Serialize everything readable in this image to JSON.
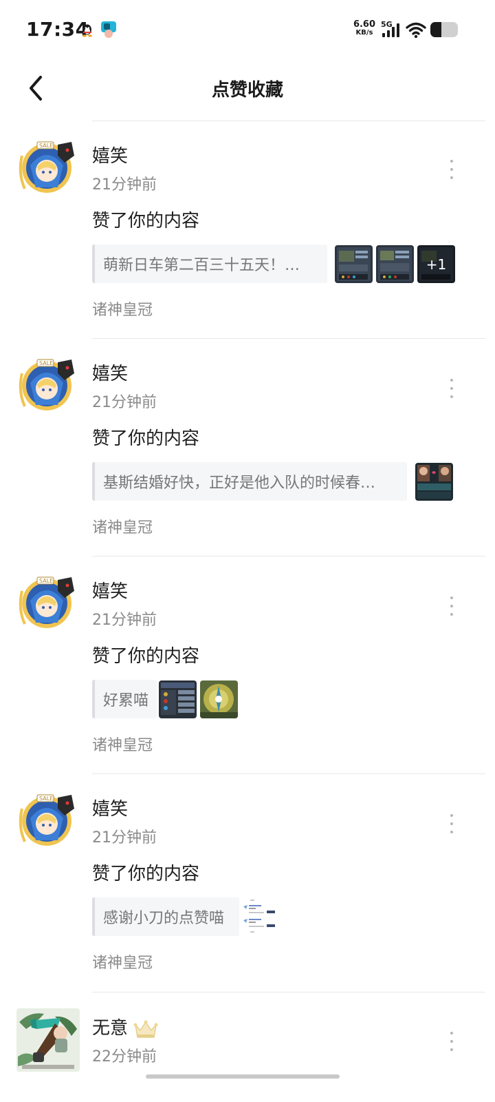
{
  "status_bar": {
    "time": "17:34",
    "net_speed_value": "6.60",
    "net_speed_unit": "KB/s",
    "network": "5G",
    "icons": [
      "qq-icon",
      "app-notification-icon",
      "signal-icon",
      "wifi-icon",
      "battery-icon"
    ]
  },
  "header": {
    "title": "点赞收藏",
    "back_icon": "back-arrow-icon"
  },
  "items": [
    {
      "user": "嬉笑",
      "time": "21分钟前",
      "action": "赞了你的内容",
      "quote": "萌新日车第二百三十五天！…",
      "thumbnails": [
        "game-screenshot",
        "game-screenshot",
        "game-screenshot"
      ],
      "more_count": "+1",
      "source": "诸神皇冠"
    },
    {
      "user": "嬉笑",
      "time": "21分钟前",
      "action": "赞了你的内容",
      "quote": "基斯结婚好快，正好是他入队的时候春…",
      "thumbnails": [
        "game-screenshot"
      ],
      "source": "诸神皇冠"
    },
    {
      "user": "嬉笑",
      "time": "21分钟前",
      "action": "赞了你的内容",
      "quote": "好累喵",
      "thumbnails": [
        "game-screenshot",
        "game-screenshot"
      ],
      "source": "诸神皇冠"
    },
    {
      "user": "嬉笑",
      "time": "21分钟前",
      "action": "赞了你的内容",
      "quote": "感谢小刀的点赞喵",
      "thumbnails": [
        "comment-screenshot"
      ],
      "source": "诸神皇冠"
    },
    {
      "user": "无意",
      "badge_icon": "crown-icon",
      "time": "22分钟前"
    }
  ],
  "colors": {
    "text_primary": "#1f1f1f",
    "text_secondary": "#8a8a8a",
    "quote_bg": "#f5f6f8",
    "divider": "#e8e8e8"
  }
}
